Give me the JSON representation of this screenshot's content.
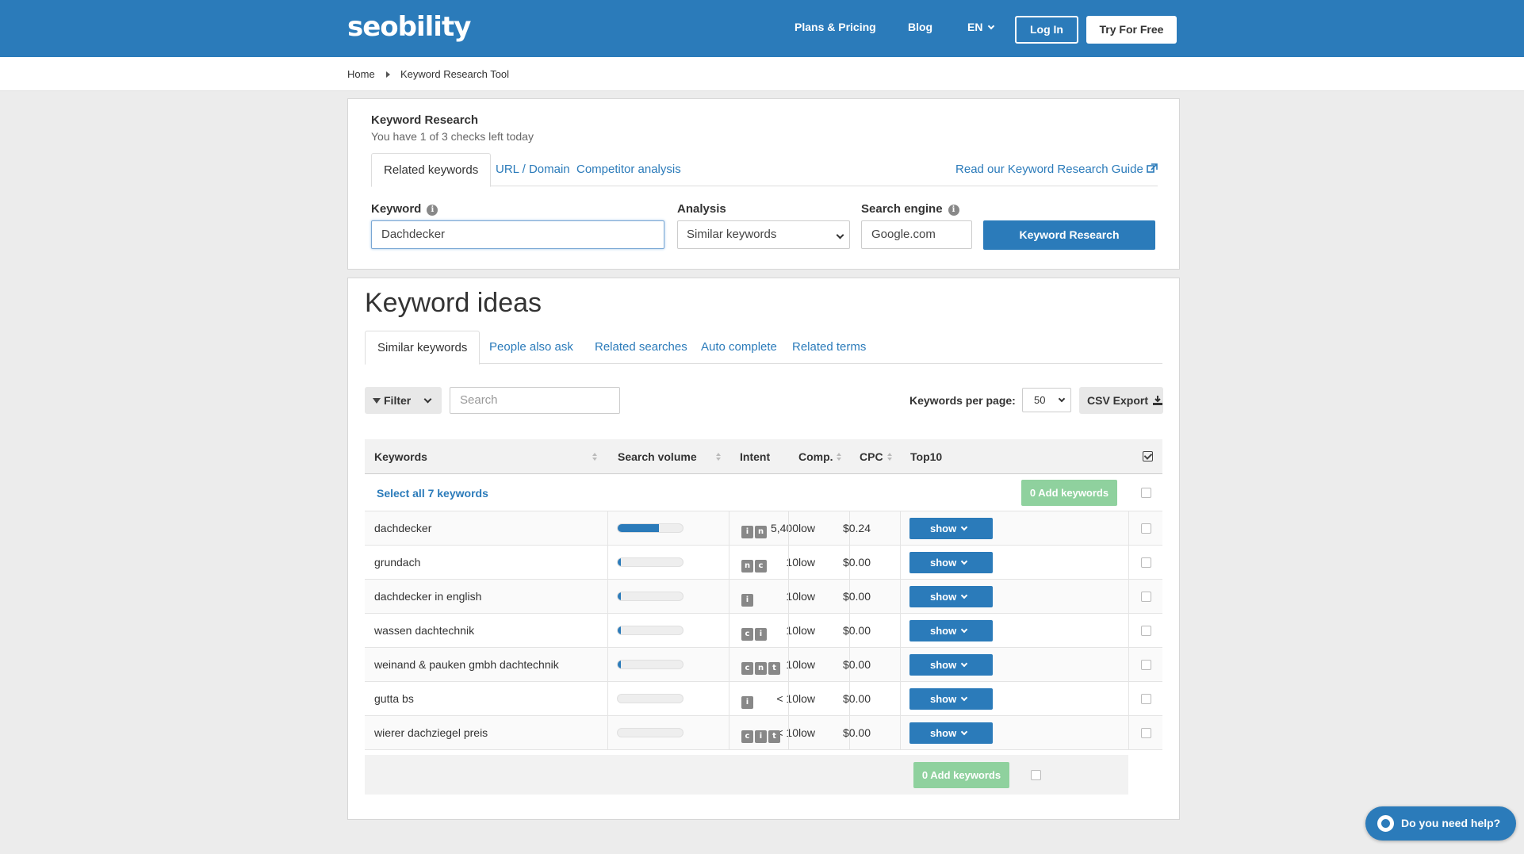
{
  "header": {
    "logo": "seobility",
    "nav": [
      "Plans & Pricing",
      "Blog",
      "EN"
    ],
    "login": "Log In",
    "try": "Try For Free"
  },
  "breadcrumb": [
    "Home",
    "Keyword Research Tool"
  ],
  "research": {
    "title": "Keyword Research",
    "subtitle": "You have 1 of 3 checks left today",
    "tabs": [
      "Related keywords",
      "URL / Domain",
      "Competitor analysis"
    ],
    "guide": "Read our Keyword Research Guide",
    "keyword_label": "Keyword",
    "keyword_value": "Dachdecker",
    "analysis_label": "Analysis",
    "analysis_value": "Similar keywords",
    "engine_label": "Search engine",
    "engine_value": "Google.com",
    "button": "Keyword Research"
  },
  "ideas": {
    "title": "Keyword ideas",
    "tabs": [
      "Similar keywords",
      "People also ask",
      "Related searches",
      "Auto complete",
      "Related terms"
    ],
    "filter": "Filter",
    "search_placeholder": "Search",
    "kpp_label": "Keywords per page:",
    "kpp_value": "50",
    "csv": "CSV Export",
    "columns": [
      "Keywords",
      "Search volume",
      "Intent",
      "Comp.",
      "CPC",
      "Top10"
    ],
    "select_all": "Select all 7 keywords",
    "add_keywords": "0 Add keywords",
    "show_label": "show",
    "rows": [
      {
        "keyword": "dachdecker",
        "volume": "5,400",
        "bar": 0.62,
        "intent": [
          "i",
          "n"
        ],
        "comp": "low",
        "cpc": "$0.24"
      },
      {
        "keyword": "grundach",
        "volume": "10",
        "bar": 0.04,
        "intent": [
          "n",
          "c"
        ],
        "comp": "low",
        "cpc": "$0.00"
      },
      {
        "keyword": "dachdecker in english",
        "volume": "10",
        "bar": 0.04,
        "intent": [
          "i"
        ],
        "comp": "low",
        "cpc": "$0.00"
      },
      {
        "keyword": "wassen dachtechnik",
        "volume": "10",
        "bar": 0.04,
        "intent": [
          "c",
          "i"
        ],
        "comp": "low",
        "cpc": "$0.00"
      },
      {
        "keyword": "weinand & pauken gmbh dachtechnik",
        "volume": "10",
        "bar": 0.04,
        "intent": [
          "c",
          "n",
          "t"
        ],
        "comp": "low",
        "cpc": "$0.00"
      },
      {
        "keyword": "gutta bs",
        "volume": "< 10",
        "bar": 0,
        "intent": [
          "i"
        ],
        "comp": "low",
        "cpc": "$0.00"
      },
      {
        "keyword": "wierer dachziegel preis",
        "volume": "< 10",
        "bar": 0,
        "intent": [
          "c",
          "i",
          "t"
        ],
        "comp": "low",
        "cpc": "$0.00"
      }
    ]
  },
  "help": "Do you need help?",
  "colors": {
    "brand": "#2b7bba",
    "add_button": "#8fd19e"
  }
}
